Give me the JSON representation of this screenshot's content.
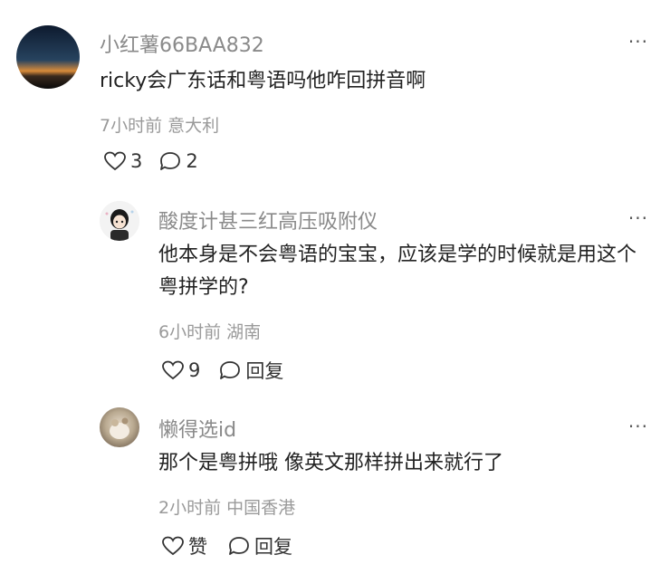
{
  "comments": [
    {
      "username": "小红薯66BAA832",
      "text": "ricky会广东话和粤语吗他咋回拼音啊",
      "time": "7小时前",
      "location": "意大利",
      "likes": "3",
      "reply": "2",
      "more": "···",
      "avatar_icon": "sunset-avatar"
    },
    {
      "username": "酸度计甚三红高压吸附仪",
      "text": "他本身是不会粤语的宝宝，应该是学的时候就是用这个粤拼学的?",
      "time": "6小时前",
      "location": "湖南",
      "likes": "9",
      "reply": "回复",
      "more": "···",
      "avatar_icon": "cartoon-avatar"
    },
    {
      "username": "懒得选id",
      "text": "那个是粤拼哦 像英文那样拼出来就行了",
      "time": "2小时前",
      "location": "中国香港",
      "likes": "赞",
      "reply": "回复",
      "more": "···",
      "avatar_icon": "photo-avatar"
    }
  ]
}
